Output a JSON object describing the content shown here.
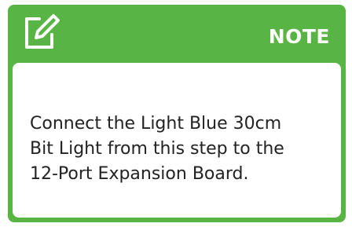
{
  "note": {
    "label": "NOTE",
    "icon": "edit-icon",
    "lines": [
      "Connect the Light Blue 30cm",
      "Bit Light from this step to the",
      "12-Port Expansion Board."
    ]
  },
  "colors": {
    "accent": "#58b443",
    "body_background": "#ffffff",
    "text": "#222222"
  }
}
